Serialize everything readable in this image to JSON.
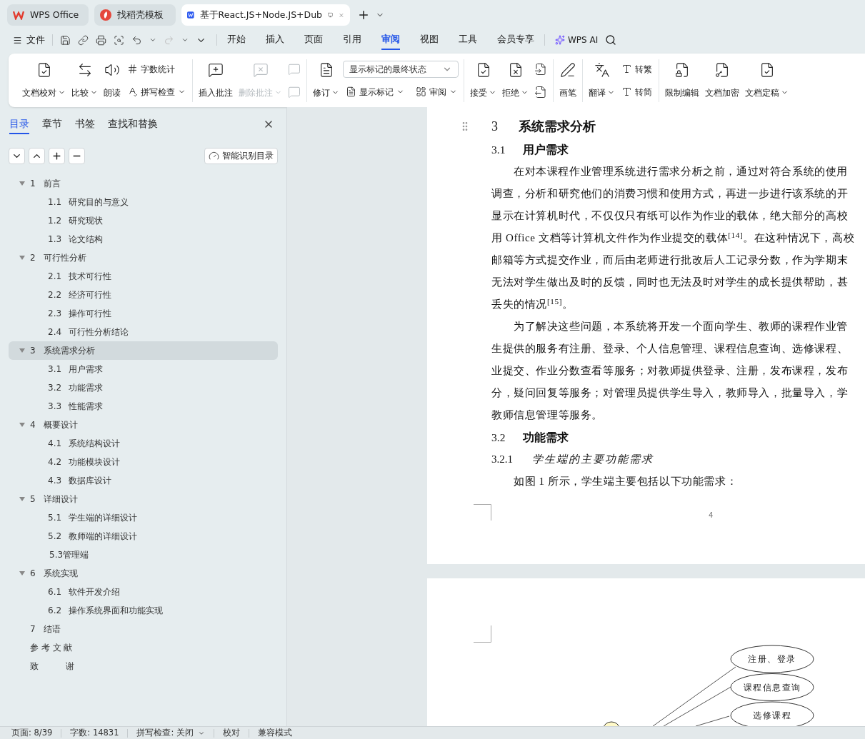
{
  "tabs": [
    {
      "kind": "home",
      "label": "WPS Office",
      "selected": false
    },
    {
      "kind": "template",
      "label": "找稻壳模板",
      "selected": false
    },
    {
      "kind": "document",
      "label": "基于React.JS+Node.JS+Dub",
      "selected": true
    }
  ],
  "menu": {
    "file": "文件",
    "tabs": [
      {
        "label": "开始",
        "selected": false
      },
      {
        "label": "插入",
        "selected": false
      },
      {
        "label": "页面",
        "selected": false
      },
      {
        "label": "引用",
        "selected": false
      },
      {
        "label": "审阅",
        "selected": true
      },
      {
        "label": "视图",
        "selected": false
      },
      {
        "label": "工具",
        "selected": false
      },
      {
        "label": "会员专享",
        "selected": false
      }
    ],
    "ai": "WPS AI"
  },
  "ribbon": [
    {
      "items": [
        {
          "kind": "large",
          "label": "文档校对",
          "has_menu": true,
          "disabled": false
        },
        {
          "kind": "large",
          "label": "比较",
          "has_menu": true,
          "disabled": false
        },
        {
          "kind": "large",
          "label": "朗读",
          "has_menu": false,
          "disabled": false
        },
        {
          "kind": "stack",
          "rows": [
            [
              {
                "kind": "button",
                "label": "字数统计",
                "has_menu": false,
                "disabled": false
              }
            ],
            [
              {
                "kind": "button",
                "label": "拼写检查",
                "has_menu": true,
                "disabled": false
              }
            ]
          ]
        }
      ]
    },
    {
      "items": [
        {
          "kind": "large",
          "label": "插入批注",
          "has_menu": false,
          "disabled": false
        },
        {
          "kind": "large",
          "label": "删除批注",
          "has_menu": true,
          "disabled": true
        },
        {
          "kind": "stack",
          "rows": [
            [
              {
                "kind": "icon-button",
                "disabled": true
              }
            ],
            [
              {
                "kind": "icon-button",
                "disabled": true
              }
            ]
          ]
        }
      ]
    },
    {
      "items": [
        {
          "kind": "large",
          "label": "修订",
          "has_menu": true,
          "disabled": false
        },
        {
          "kind": "stack",
          "rows": [
            [
              {
                "kind": "select",
                "value": "显示标记的最终状态"
              }
            ],
            [
              {
                "kind": "button",
                "label": "显示标记",
                "has_menu": true,
                "disabled": false
              },
              {
                "kind": "button",
                "label": "审阅",
                "has_menu": true,
                "disabled": false
              }
            ]
          ]
        }
      ]
    },
    {
      "items": [
        {
          "kind": "large",
          "label": "接受",
          "has_menu": true,
          "disabled": false
        },
        {
          "kind": "large",
          "label": "拒绝",
          "has_menu": true,
          "disabled": false
        },
        {
          "kind": "stack",
          "rows": [
            [
              {
                "kind": "icon-button",
                "disabled": false
              }
            ],
            [
              {
                "kind": "icon-button",
                "disabled": false
              }
            ]
          ]
        }
      ]
    },
    {
      "items": [
        {
          "kind": "large",
          "label": "画笔",
          "has_menu": false,
          "disabled": false
        }
      ]
    },
    {
      "items": [
        {
          "kind": "large",
          "label": "翻译",
          "has_menu": true,
          "disabled": false
        },
        {
          "kind": "stack",
          "rows": [
            [
              {
                "kind": "button",
                "label": "转繁",
                "has_menu": false,
                "disabled": false
              }
            ],
            [
              {
                "kind": "button",
                "label": "转简",
                "has_menu": false,
                "disabled": false
              }
            ]
          ]
        }
      ]
    },
    {
      "items": [
        {
          "kind": "large",
          "label": "限制编辑",
          "has_menu": false,
          "disabled": false
        },
        {
          "kind": "large",
          "label": "文档加密",
          "has_menu": false,
          "disabled": false
        },
        {
          "kind": "large",
          "label": "文档定稿",
          "has_menu": true,
          "disabled": false
        }
      ]
    }
  ],
  "sidebar": {
    "tabs": [
      {
        "label": "目录",
        "selected": true
      },
      {
        "label": "章节",
        "selected": false
      },
      {
        "label": "书签",
        "selected": false
      },
      {
        "label": "查找和替换",
        "selected": false
      }
    ],
    "smart_button": "智能识别目录",
    "toc": [
      {
        "number": "1",
        "title": "前言",
        "selected": false,
        "expanded": true,
        "children": [
          {
            "number": "1.1",
            "title": "研究目的与意义",
            "selected": false
          },
          {
            "number": "1.2",
            "title": "研究现状",
            "selected": false
          },
          {
            "number": "1.3",
            "title": "论文结构",
            "selected": false
          }
        ]
      },
      {
        "number": "2",
        "title": "可行性分析",
        "selected": false,
        "expanded": true,
        "children": [
          {
            "number": "2.1",
            "title": "技术可行性",
            "selected": false
          },
          {
            "number": "2.2",
            "title": "经济可行性",
            "selected": false
          },
          {
            "number": "2.3",
            "title": "操作可行性",
            "selected": false
          },
          {
            "number": "2.4",
            "title": "可行性分析结论",
            "selected": false
          }
        ]
      },
      {
        "number": "3",
        "title": "系统需求分析",
        "selected": true,
        "expanded": true,
        "children": [
          {
            "number": "3.1",
            "title": "用户需求",
            "selected": false
          },
          {
            "number": "3.2",
            "title": "功能需求",
            "selected": false
          },
          {
            "number": "3.3",
            "title": "性能需求",
            "selected": false
          }
        ]
      },
      {
        "number": "4",
        "title": "概要设计",
        "selected": false,
        "expanded": true,
        "children": [
          {
            "number": "4.1",
            "title": "系统结构设计",
            "selected": false
          },
          {
            "number": "4.2",
            "title": "功能模块设计",
            "selected": false
          },
          {
            "number": "4.3",
            "title": "数据库设计",
            "selected": false
          }
        ]
      },
      {
        "number": "5",
        "title": "详细设计",
        "selected": false,
        "expanded": true,
        "children": [
          {
            "number": "5.1",
            "title": "学生端的详细设计",
            "selected": false
          },
          {
            "number": "5.2",
            "title": "教师端的详细设计",
            "selected": false
          },
          {
            "title": "5.3管理端",
            "selected": false
          }
        ]
      },
      {
        "number": "6",
        "title": "系统实现",
        "selected": false,
        "expanded": true,
        "children": [
          {
            "number": "6.1",
            "title": "软件开发介绍",
            "selected": false
          },
          {
            "number": "6.2",
            "title": "操作系统界面和功能实现",
            "selected": false
          }
        ]
      },
      {
        "number": "7",
        "title": "结语",
        "selected": false
      },
      {
        "title": "参 考 文 献",
        "selected": false
      },
      {
        "title": "致          谢",
        "selected": false
      }
    ]
  },
  "document": {
    "page": {
      "blocks": [
        {
          "kind": "h1",
          "number": "3",
          "title": "系统需求分析"
        },
        {
          "kind": "h2",
          "number": "3.1",
          "title": "用户需求"
        },
        {
          "kind": "paragraph",
          "lines": [
            "在对本课程作业管理系统进行需求分析之前，通过对符合系统的使用",
            "调查，分析和研究他们的消费习惯和使用方式，再进一步进行该系统的开",
            "显示在计算机时代，不仅仅只有纸可以作为作业的载体，绝大部分的高校",
            "用 Office 文档等计算机文件作为作业提交的载体$^{[14]}$。在这种情况下，高校",
            "邮箱等方式提交作业，而后由老师进行批改后人工记录分数，作为学期末",
            "无法对学生做出及时的反馈，同时也无法及时对学生的成长提供帮助，甚",
            "丢失的情况$^{[15]}$。"
          ]
        },
        {
          "kind": "paragraph",
          "lines": [
            "为了解决这些问题，本系统将开发一个面向学生、教师的课程作业管",
            "生提供的服务有注册、登录、个人信息管理、课程信息查询、选修课程、",
            "业提交、作业分数查看等服务；对教师提供登录、注册，发布课程，发布",
            "分，疑问回复等服务；对管理员提供学生导入，教师导入，批量导入，学",
            "教师信息管理等服务。"
          ]
        },
        {
          "kind": "h2",
          "number": "3.2",
          "title": "功能需求"
        },
        {
          "kind": "h3",
          "number": "3.2.1",
          "title": "学生端的主要功能需求"
        },
        {
          "kind": "paragraph",
          "lines": [
            "如图 1 所示，学生端主要包括以下功能需求："
          ]
        }
      ],
      "page_number": "4"
    },
    "diagram": {
      "use_cases": [
        "注册、登录",
        "课程信息查询",
        "选修课程"
      ]
    }
  },
  "status_bar": [
    {
      "kind": "text",
      "label": "页面: 8/39"
    },
    {
      "kind": "text",
      "label": "字数: 14831"
    },
    {
      "kind": "dropdown",
      "label": "拼写检查: 关闭"
    },
    {
      "kind": "text",
      "label": "校对"
    },
    {
      "kind": "text",
      "label": "兼容模式"
    }
  ]
}
